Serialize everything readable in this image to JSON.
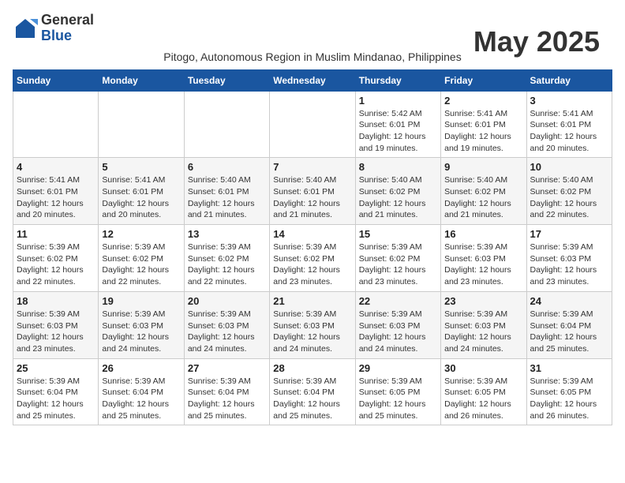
{
  "logo": {
    "general": "General",
    "blue": "Blue"
  },
  "title": "May 2025",
  "location": "Pitogo, Autonomous Region in Muslim Mindanao, Philippines",
  "days_of_week": [
    "Sunday",
    "Monday",
    "Tuesday",
    "Wednesday",
    "Thursday",
    "Friday",
    "Saturday"
  ],
  "weeks": [
    [
      {
        "day": "",
        "info": ""
      },
      {
        "day": "",
        "info": ""
      },
      {
        "day": "",
        "info": ""
      },
      {
        "day": "",
        "info": ""
      },
      {
        "day": "1",
        "info": "Sunrise: 5:42 AM\nSunset: 6:01 PM\nDaylight: 12 hours and 19 minutes."
      },
      {
        "day": "2",
        "info": "Sunrise: 5:41 AM\nSunset: 6:01 PM\nDaylight: 12 hours and 19 minutes."
      },
      {
        "day": "3",
        "info": "Sunrise: 5:41 AM\nSunset: 6:01 PM\nDaylight: 12 hours and 20 minutes."
      }
    ],
    [
      {
        "day": "4",
        "info": "Sunrise: 5:41 AM\nSunset: 6:01 PM\nDaylight: 12 hours and 20 minutes."
      },
      {
        "day": "5",
        "info": "Sunrise: 5:41 AM\nSunset: 6:01 PM\nDaylight: 12 hours and 20 minutes."
      },
      {
        "day": "6",
        "info": "Sunrise: 5:40 AM\nSunset: 6:01 PM\nDaylight: 12 hours and 21 minutes."
      },
      {
        "day": "7",
        "info": "Sunrise: 5:40 AM\nSunset: 6:01 PM\nDaylight: 12 hours and 21 minutes."
      },
      {
        "day": "8",
        "info": "Sunrise: 5:40 AM\nSunset: 6:02 PM\nDaylight: 12 hours and 21 minutes."
      },
      {
        "day": "9",
        "info": "Sunrise: 5:40 AM\nSunset: 6:02 PM\nDaylight: 12 hours and 21 minutes."
      },
      {
        "day": "10",
        "info": "Sunrise: 5:40 AM\nSunset: 6:02 PM\nDaylight: 12 hours and 22 minutes."
      }
    ],
    [
      {
        "day": "11",
        "info": "Sunrise: 5:39 AM\nSunset: 6:02 PM\nDaylight: 12 hours and 22 minutes."
      },
      {
        "day": "12",
        "info": "Sunrise: 5:39 AM\nSunset: 6:02 PM\nDaylight: 12 hours and 22 minutes."
      },
      {
        "day": "13",
        "info": "Sunrise: 5:39 AM\nSunset: 6:02 PM\nDaylight: 12 hours and 22 minutes."
      },
      {
        "day": "14",
        "info": "Sunrise: 5:39 AM\nSunset: 6:02 PM\nDaylight: 12 hours and 23 minutes."
      },
      {
        "day": "15",
        "info": "Sunrise: 5:39 AM\nSunset: 6:02 PM\nDaylight: 12 hours and 23 minutes."
      },
      {
        "day": "16",
        "info": "Sunrise: 5:39 AM\nSunset: 6:03 PM\nDaylight: 12 hours and 23 minutes."
      },
      {
        "day": "17",
        "info": "Sunrise: 5:39 AM\nSunset: 6:03 PM\nDaylight: 12 hours and 23 minutes."
      }
    ],
    [
      {
        "day": "18",
        "info": "Sunrise: 5:39 AM\nSunset: 6:03 PM\nDaylight: 12 hours and 23 minutes."
      },
      {
        "day": "19",
        "info": "Sunrise: 5:39 AM\nSunset: 6:03 PM\nDaylight: 12 hours and 24 minutes."
      },
      {
        "day": "20",
        "info": "Sunrise: 5:39 AM\nSunset: 6:03 PM\nDaylight: 12 hours and 24 minutes."
      },
      {
        "day": "21",
        "info": "Sunrise: 5:39 AM\nSunset: 6:03 PM\nDaylight: 12 hours and 24 minutes."
      },
      {
        "day": "22",
        "info": "Sunrise: 5:39 AM\nSunset: 6:03 PM\nDaylight: 12 hours and 24 minutes."
      },
      {
        "day": "23",
        "info": "Sunrise: 5:39 AM\nSunset: 6:03 PM\nDaylight: 12 hours and 24 minutes."
      },
      {
        "day": "24",
        "info": "Sunrise: 5:39 AM\nSunset: 6:04 PM\nDaylight: 12 hours and 25 minutes."
      }
    ],
    [
      {
        "day": "25",
        "info": "Sunrise: 5:39 AM\nSunset: 6:04 PM\nDaylight: 12 hours and 25 minutes."
      },
      {
        "day": "26",
        "info": "Sunrise: 5:39 AM\nSunset: 6:04 PM\nDaylight: 12 hours and 25 minutes."
      },
      {
        "day": "27",
        "info": "Sunrise: 5:39 AM\nSunset: 6:04 PM\nDaylight: 12 hours and 25 minutes."
      },
      {
        "day": "28",
        "info": "Sunrise: 5:39 AM\nSunset: 6:04 PM\nDaylight: 12 hours and 25 minutes."
      },
      {
        "day": "29",
        "info": "Sunrise: 5:39 AM\nSunset: 6:05 PM\nDaylight: 12 hours and 25 minutes."
      },
      {
        "day": "30",
        "info": "Sunrise: 5:39 AM\nSunset: 6:05 PM\nDaylight: 12 hours and 26 minutes."
      },
      {
        "day": "31",
        "info": "Sunrise: 5:39 AM\nSunset: 6:05 PM\nDaylight: 12 hours and 26 minutes."
      }
    ]
  ]
}
